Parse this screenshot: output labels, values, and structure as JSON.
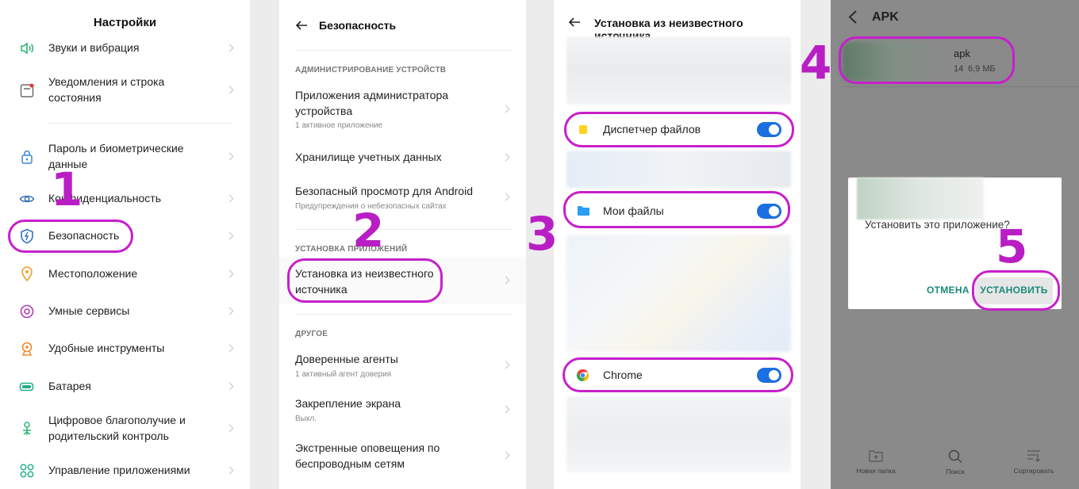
{
  "settings": {
    "title": "Настройки",
    "items": [
      {
        "label": "Звуки и вибрация",
        "icon": "sound-icon"
      },
      {
        "label": "Уведомления и строка состояния",
        "icon": "notification-icon"
      },
      {
        "label": "Пароль и биометрические данные",
        "icon": "lock-icon"
      },
      {
        "label": "Конфиденциальность",
        "icon": "privacy-eye-icon"
      },
      {
        "label": "Безопасность",
        "icon": "shield-icon"
      },
      {
        "label": "Местоположение",
        "icon": "location-pin-icon"
      },
      {
        "label": "Умные сервисы",
        "icon": "smart-services-icon"
      },
      {
        "label": "Удобные инструменты",
        "icon": "tools-icon"
      },
      {
        "label": "Батарея",
        "icon": "battery-icon"
      },
      {
        "label": "Цифровое благополучие и родительский контроль",
        "icon": "wellbeing-icon"
      },
      {
        "label": "Управление приложениями",
        "icon": "apps-grid-icon"
      }
    ]
  },
  "security": {
    "title": "Безопасность",
    "section_admin": "АДМИНИСТРИРОВАНИЕ УСТРОЙСТВ",
    "admin_apps": {
      "title": "Приложения администратора устройства",
      "subtitle": "1 активное приложение"
    },
    "credentials": {
      "title": "Хранилище учетных данных"
    },
    "safe_browsing": {
      "title": "Безопасный просмотр для Android",
      "subtitle": "Предупреждения о небезопасных сайтах"
    },
    "section_install": "УСТАНОВКА ПРИЛОЖЕНИЙ",
    "unknown_sources": {
      "title": "Установка из неизвестного источника"
    },
    "section_other": "ДРУГОЕ",
    "trust_agents": {
      "title": "Доверенные агенты",
      "subtitle": "1 активный агент доверия"
    },
    "screen_pinning": {
      "title": "Закрепление экрана",
      "subtitle": "Выкл."
    },
    "emergency_alerts": {
      "title": "Экстренные оповещения по беспроводным сетям"
    }
  },
  "unknown_source": {
    "title": "Установка из неизвестного источника",
    "apps": [
      {
        "label": "Диспетчер файлов",
        "icon": "file-manager-icon",
        "enabled": true
      },
      {
        "label": "Мои файлы",
        "icon": "folder-icon",
        "enabled": true
      },
      {
        "label": "Chrome",
        "icon": "chrome-icon",
        "enabled": true
      }
    ]
  },
  "file_browser": {
    "title": "APK",
    "file": {
      "name_fragment": "apk",
      "meta_fragment": "14",
      "size": "6,9 МБ"
    },
    "dialog": {
      "question": "Установить это приложение?",
      "cancel": "ОТМЕНА",
      "install": "УСТАНОВИТЬ"
    },
    "bottom_bar": {
      "new_folder": "Новая папка",
      "search": "Поиск",
      "sort": "Сортировать"
    }
  },
  "steps": [
    "1",
    "2",
    "3",
    "4",
    "5"
  ],
  "colors": {
    "annotation": "#c71fcb",
    "toggle_on": "#1b6fe0",
    "dialog_button": "#1a8a7a"
  }
}
